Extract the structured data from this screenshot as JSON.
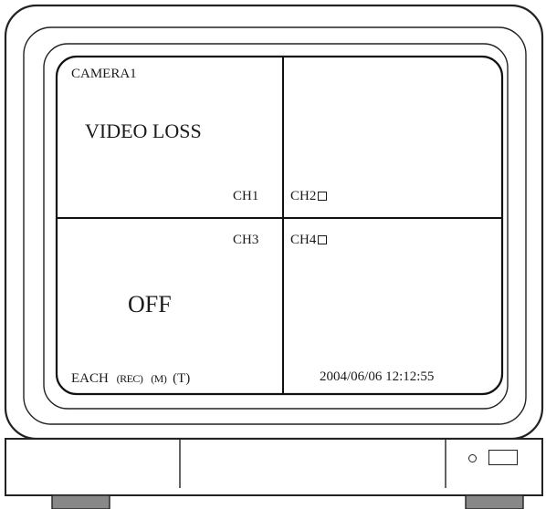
{
  "screen": {
    "camera_label": "CAMERA1",
    "video_loss": "VIDEO LOSS",
    "off_label": "OFF",
    "date_time": "2004/06/06 12:12:55",
    "mode_label": "EACH",
    "rec_label": "(REC)",
    "m_label": "(M)",
    "t_label": "(T)"
  },
  "channels": {
    "ch1": "CH1",
    "ch2": "CH2",
    "ch3": "CH3",
    "ch4": "CH4"
  }
}
